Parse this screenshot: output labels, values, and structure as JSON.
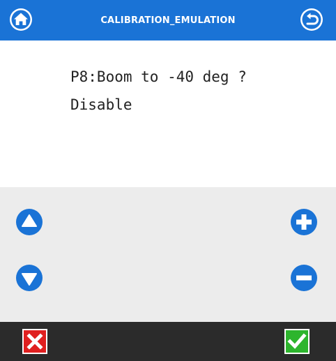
{
  "header": {
    "title": "CALIBRATION_EMULATION",
    "home_icon": "home-icon",
    "back_icon": "undo-arrow-icon",
    "background_color": "#1a73d6"
  },
  "message": {
    "line1": "P8:Boom to -40 deg ?",
    "line2": "Disable"
  },
  "controls": {
    "up_icon": "triangle-up-icon",
    "down_icon": "triangle-down-icon",
    "plus_icon": "plus-icon",
    "minus_icon": "minus-icon",
    "button_color": "#1a73d6"
  },
  "footer": {
    "cancel_icon": "x-icon",
    "confirm_icon": "check-icon",
    "cancel_color": "#e02020",
    "confirm_color": "#2db52d"
  }
}
